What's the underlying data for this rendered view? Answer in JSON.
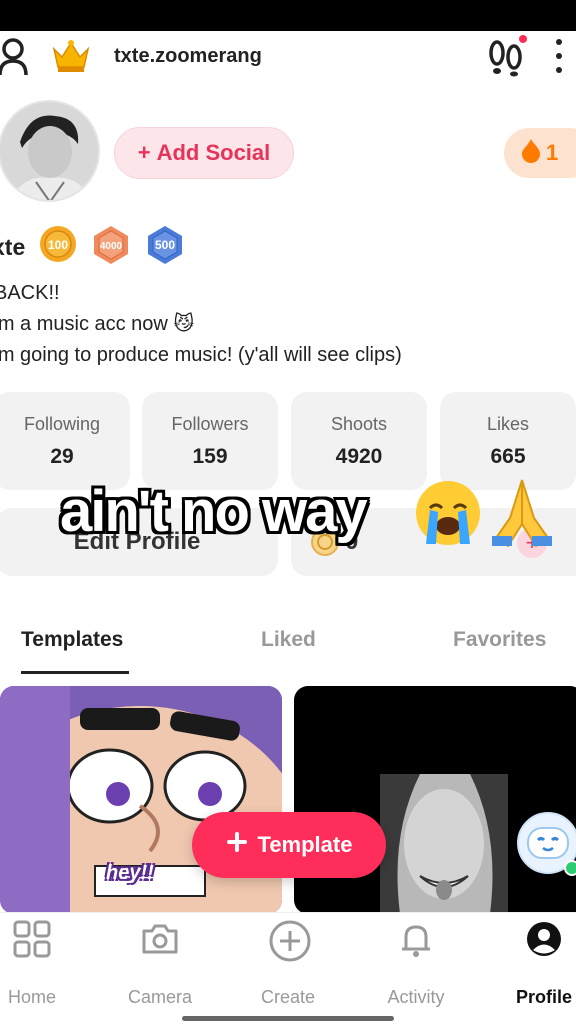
{
  "header": {
    "username": "txte.zoomerang",
    "icons": [
      "user-icon",
      "crown-icon",
      "footsteps-icon",
      "more-icon"
    ]
  },
  "profile": {
    "add_social_label": "Add Social",
    "streak_count": "1",
    "display_name": "xte",
    "badges": [
      "100",
      "4000",
      "500"
    ],
    "bio_lines": [
      "BACK!!",
      "'m a music acc now 😼",
      "'m going to produce music! (y'all will see clips)"
    ]
  },
  "stats": [
    {
      "label": "Following",
      "value": "29"
    },
    {
      "label": "Followers",
      "value": "159"
    },
    {
      "label": "Shoots",
      "value": "4920"
    },
    {
      "label": "Likes",
      "value": "665"
    }
  ],
  "actions": {
    "edit_profile_label": "Edit Profile",
    "coins_value": "0",
    "coins_plus": "+"
  },
  "overlay": {
    "caption": "ain't no way",
    "emoji_cry": "😭",
    "emoji_pray": "🙏"
  },
  "tabs": [
    {
      "label": "Templates",
      "active": true
    },
    {
      "label": "Liked",
      "active": false
    },
    {
      "label": "Favorites",
      "active": false
    }
  ],
  "grid": {
    "thumb1_caption": "hey!!"
  },
  "fab": {
    "label": "Template"
  },
  "bottom_nav": [
    {
      "label": "Home",
      "icon": "grid-icon",
      "active": false
    },
    {
      "label": "Camera",
      "icon": "camera-icon",
      "active": false
    },
    {
      "label": "Create",
      "icon": "plus-circle-icon",
      "active": false
    },
    {
      "label": "Activity",
      "icon": "bell-icon",
      "active": false
    },
    {
      "label": "Profile",
      "icon": "profile-icon",
      "active": true
    }
  ],
  "colors": {
    "accent": "#ff2d5a",
    "streak": "#ff7a00",
    "badge_100": "#f5a623",
    "badge_4000": "#f08a5d",
    "badge_500": "#4a7bd8"
  }
}
